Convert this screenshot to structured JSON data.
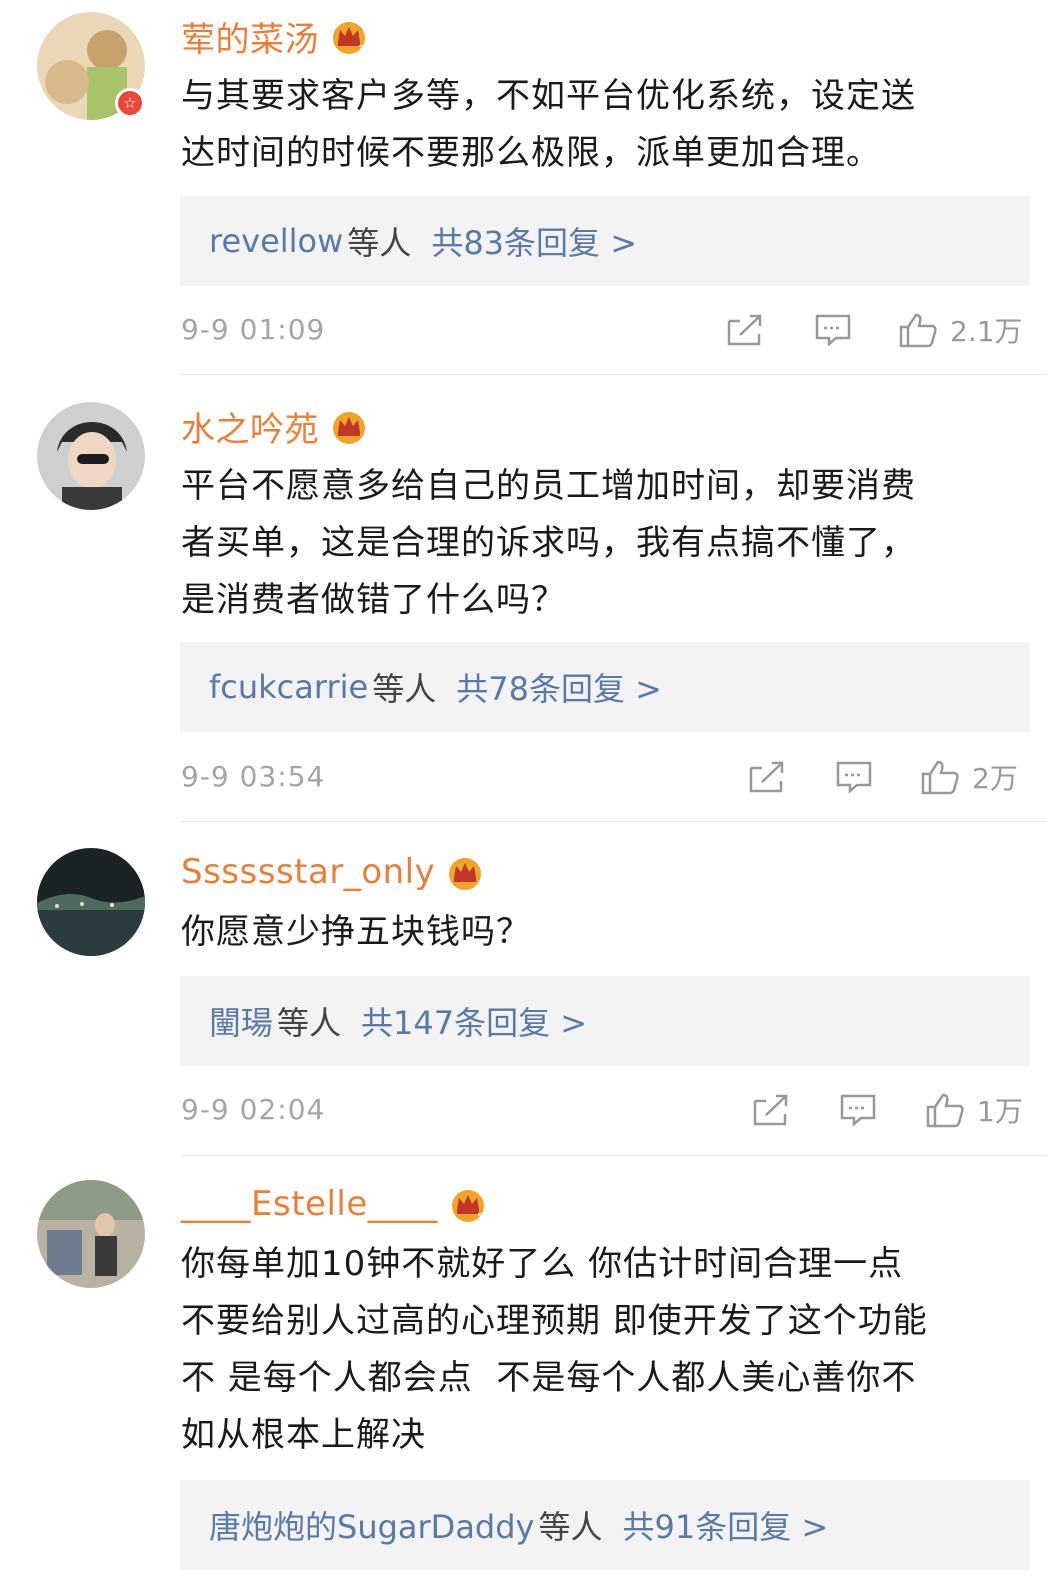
{
  "comments": [
    {
      "username": "荤的菜汤",
      "crown_level": "3",
      "text": "与其要求客户多等，不如平台优化系统，设定送\n达时间的时候不要那么极限，派单更加合理。",
      "reply_user": "revellow",
      "reply_suffix": "等人",
      "reply_count": "共83条回复 >",
      "time": "9-9 01:09",
      "likes": "2.1万",
      "avatar_colors": [
        "#e9d7b8",
        "#c9a16d"
      ]
    },
    {
      "username": "水之吟苑",
      "crown_level": "",
      "text": "平台不愿意多给自己的员工增加时间，却要消费\n者买单，这是合理的诉求吗，我有点搞不懂了，\n是消费者做错了什么吗？",
      "reply_user": "fcukcarrie",
      "reply_suffix": "等人",
      "reply_count": "共78条回复 >",
      "time": "9-9 03:54",
      "likes": "2万",
      "avatar_colors": [
        "#cfcfcf",
        "#2a2a2a"
      ]
    },
    {
      "username": "Sssssstar_only",
      "crown_level": "",
      "text": "你愿意少挣五块钱吗？",
      "reply_user": "闉瑒",
      "reply_suffix": "等人",
      "reply_count": "共147条回复 >",
      "time": "9-9 02:04",
      "likes": "1万",
      "avatar_colors": [
        "#1c2326",
        "#4d6b5e"
      ]
    },
    {
      "username": "____Estelle____",
      "crown_level": "5",
      "text": "你每单加10钟不就好了么 你估计时间合理一点\n不要给别人过高的心理预期 即使开发了这个功能\n不 是每个人都会点  不是每个人都人美心善你不\n如从根本上解决",
      "reply_user": "唐炮炮的SugarDaddy",
      "reply_suffix": "等人",
      "reply_count": "共91条回复 >",
      "time": "",
      "likes": "",
      "avatar_colors": [
        "#b9b2a3",
        "#3a3a3a"
      ]
    }
  ],
  "colors": {
    "username": "#e8803a",
    "reply_link": "#5a7aa3",
    "meta": "#a5a5a5",
    "reply_bg": "#f3f3f5",
    "crown": "#f0a429"
  },
  "icons": {
    "share": "share-icon",
    "comment": "comment-icon",
    "like": "thumbs-up-icon",
    "crown": "crown-icon",
    "verified": "verified-badge-icon"
  },
  "verified_badge": "☆"
}
